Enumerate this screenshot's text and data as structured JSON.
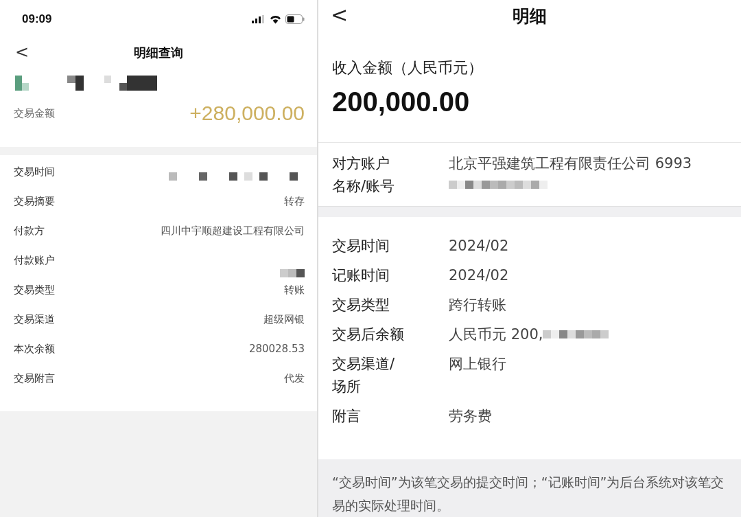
{
  "left_screen": {
    "status_bar": {
      "time": "09:09"
    },
    "nav": {
      "back": "<",
      "title": "明细查询"
    },
    "account": {
      "redacted": true
    },
    "amount": {
      "label": "交易金额",
      "value": "+280,000.00"
    },
    "rows": [
      {
        "label": "交易时间",
        "redacted": true
      },
      {
        "label": "交易摘要",
        "value": "转存",
        "redacted": false
      },
      {
        "label": "付款方",
        "value": "四川中宇顺超建设工程有限公司",
        "redacted": false
      },
      {
        "label": "付款账户",
        "redacted": true
      },
      {
        "label": "交易类型",
        "value": "转账",
        "redacted": false
      },
      {
        "label": "交易渠道",
        "value": "超级网银",
        "redacted": false
      },
      {
        "label": "本次余额",
        "value": "280028.53",
        "redacted": false
      },
      {
        "label": "交易附言",
        "value": "代发",
        "redacted": false
      }
    ]
  },
  "right_screen": {
    "nav": {
      "back": "<",
      "title": "明细"
    },
    "amount": {
      "label": "收入金额（人民币元）",
      "value": "200,000.00"
    },
    "counterparty": {
      "label": [
        "对方账户",
        "名称/账号"
      ],
      "value": "北京平强建筑工程有限责任公司 6993",
      "redacted": true
    },
    "rows": [
      {
        "label": [
          "交易时间"
        ],
        "value": "2024/02",
        "redacted": false
      },
      {
        "label": [
          "记账时间"
        ],
        "value": "2024/02",
        "redacted": false
      },
      {
        "label": [
          "交易类型"
        ],
        "value": "跨行转账",
        "redacted": false
      },
      {
        "label": [
          "交易后余额"
        ],
        "value": "人民币元 200,",
        "redacted": true
      },
      {
        "label": [
          "交易渠道/",
          "场所"
        ],
        "value": "网上银行",
        "redacted": false
      },
      {
        "label": [
          "附言"
        ],
        "value": "劳务费",
        "redacted": false
      }
    ],
    "note": "“交易时间”为该笔交易的提交时间；“记账时间”为后台系统对该笔交易的实际处理时间。"
  }
}
